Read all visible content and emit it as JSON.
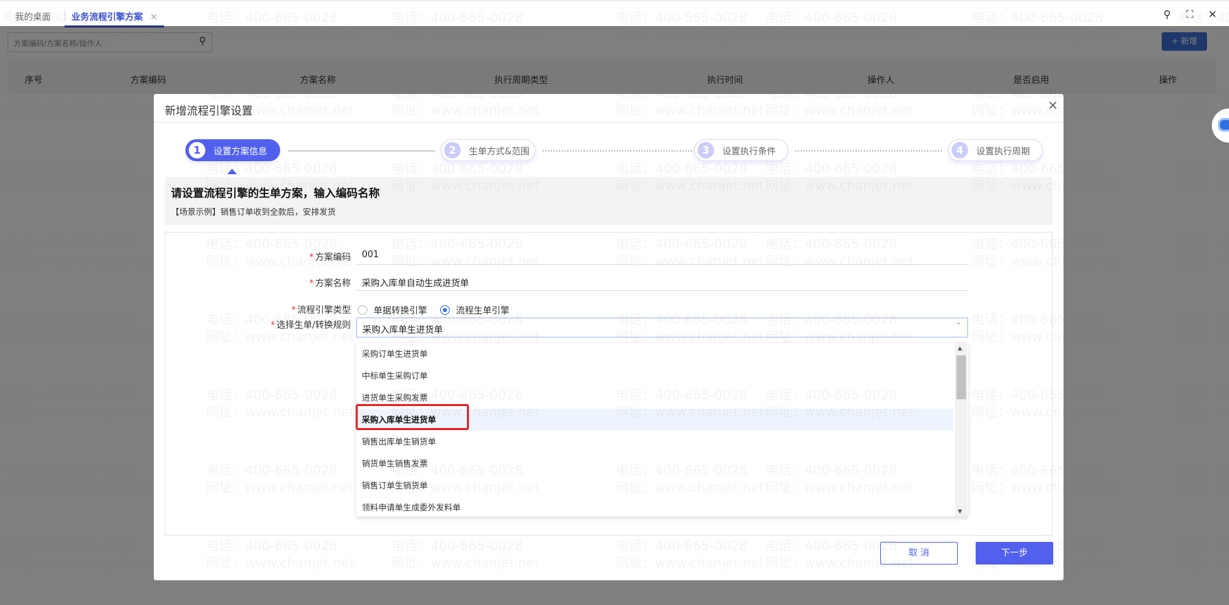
{
  "tabs": [
    {
      "label": "我的桌面"
    },
    {
      "label": "业务流程引擎方案",
      "active": true
    }
  ],
  "window_icons": [
    "search-icon",
    "fullscreen-icon",
    "close-icon"
  ],
  "list": {
    "search_placeholder": "方案编码/方案名称/操作人",
    "add_label": "+ 新增",
    "columns": [
      "序号",
      "方案编码",
      "方案名称",
      "执行周期类型",
      "执行时间",
      "操作人",
      "是否启用",
      "操作"
    ]
  },
  "watermark": {
    "phone": "电话：400-665-0028",
    "web": "网址：www.chanjet.net"
  },
  "modal": {
    "title": "新增流程引擎设置",
    "steps": [
      {
        "num": "1",
        "label": "设置方案信息",
        "active": true
      },
      {
        "num": "2",
        "label": "生单方式&范围"
      },
      {
        "num": "3",
        "label": "设置执行条件"
      },
      {
        "num": "4",
        "label": "设置执行周期"
      }
    ],
    "info_heading": "请设置流程引擎的生单方案，输入编码名称",
    "info_example": "【场景示例】销售订单收到全款后，安排发货",
    "form": {
      "code_label": "方案编码",
      "code_value": "001",
      "name_label": "方案名称",
      "name_value": "采购入库单自动生成进货单",
      "type_label": "流程引擎类型",
      "type_options": [
        "单据转换引擎",
        "流程生单引擎"
      ],
      "type_selected": "流程生单引擎",
      "rule_label": "选择生单/转换规则",
      "rule_value": "采购入库单生进货单",
      "rule_options": [
        "采购订单生进货单",
        "中标单生采购订单",
        "进货单生采购发票",
        "采购入库单生进货单",
        "销售出库单生销货单",
        "销货单生销售发票",
        "销售订单生销货单",
        "领料申请单生成委外发料单"
      ],
      "highlighted_option": "采购入库单生进货单"
    },
    "cancel_label": "取 消",
    "next_label": "下一步"
  },
  "colors": {
    "accent": "#5160ef",
    "highlight_box": "#e5262a",
    "tab_active": "#3d52d5"
  }
}
